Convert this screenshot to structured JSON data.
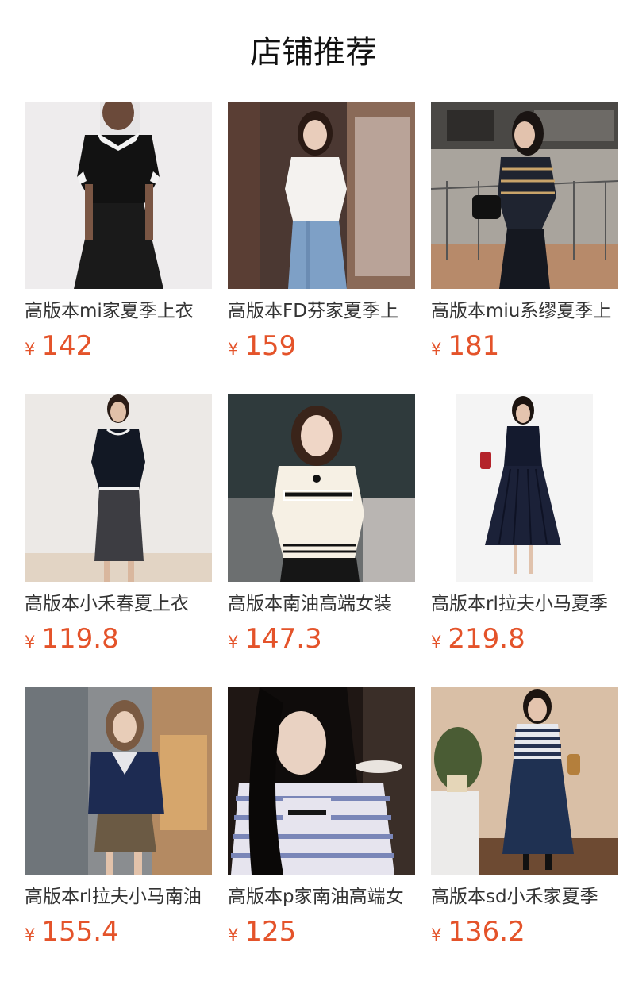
{
  "header": {
    "title": "店铺推荐"
  },
  "colors": {
    "price": "#e4532a",
    "title": "#111111",
    "text": "#333333"
  },
  "products": [
    {
      "name": "高版本mi家夏季上衣",
      "currency": "¥",
      "price": "142",
      "image_icon": "product-photo-icon"
    },
    {
      "name": "高版本FD芬家夏季上",
      "currency": "¥",
      "price": "159",
      "image_icon": "product-photo-icon"
    },
    {
      "name": "高版本miu系缪夏季上",
      "currency": "¥",
      "price": "181",
      "image_icon": "product-photo-icon"
    },
    {
      "name": "高版本小禾春夏上衣",
      "currency": "¥",
      "price": "119.8",
      "image_icon": "product-photo-icon"
    },
    {
      "name": "高版本南油高端女装",
      "currency": "¥",
      "price": "147.3",
      "image_icon": "product-photo-icon"
    },
    {
      "name": "高版本rl拉夫小马夏季",
      "currency": "¥",
      "price": "219.8",
      "image_icon": "product-photo-icon"
    },
    {
      "name": "高版本rl拉夫小马南油",
      "currency": "¥",
      "price": "155.4",
      "image_icon": "product-photo-icon"
    },
    {
      "name": "高版本p家南油高端女",
      "currency": "¥",
      "price": "125",
      "image_icon": "product-photo-icon"
    },
    {
      "name": "高版本sd小禾家夏季",
      "currency": "¥",
      "price": "136.2",
      "image_icon": "product-photo-icon"
    }
  ]
}
